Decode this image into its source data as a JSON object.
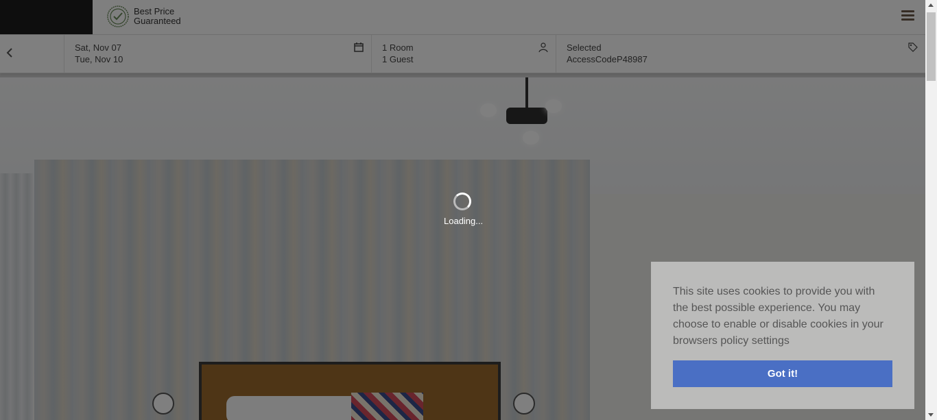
{
  "header": {
    "badge_line1": "Best Price",
    "badge_line2": "Guaranteed"
  },
  "booking": {
    "check_in": "Sat, Nov 07",
    "check_out": "Tue, Nov 10",
    "rooms": "1 Room",
    "guests": "1 Guest",
    "promo_label": "Selected",
    "promo_code": "AccessCodeP48987"
  },
  "loader": {
    "text": "Loading..."
  },
  "cookie": {
    "message": "This site uses cookies to provide you with the best possible experience. You may choose to enable or disable cookies in your browsers policy settings",
    "button": "Got it!"
  },
  "colors": {
    "accent": "#4a6fc4",
    "menu_icon": "#6d5a4a"
  }
}
